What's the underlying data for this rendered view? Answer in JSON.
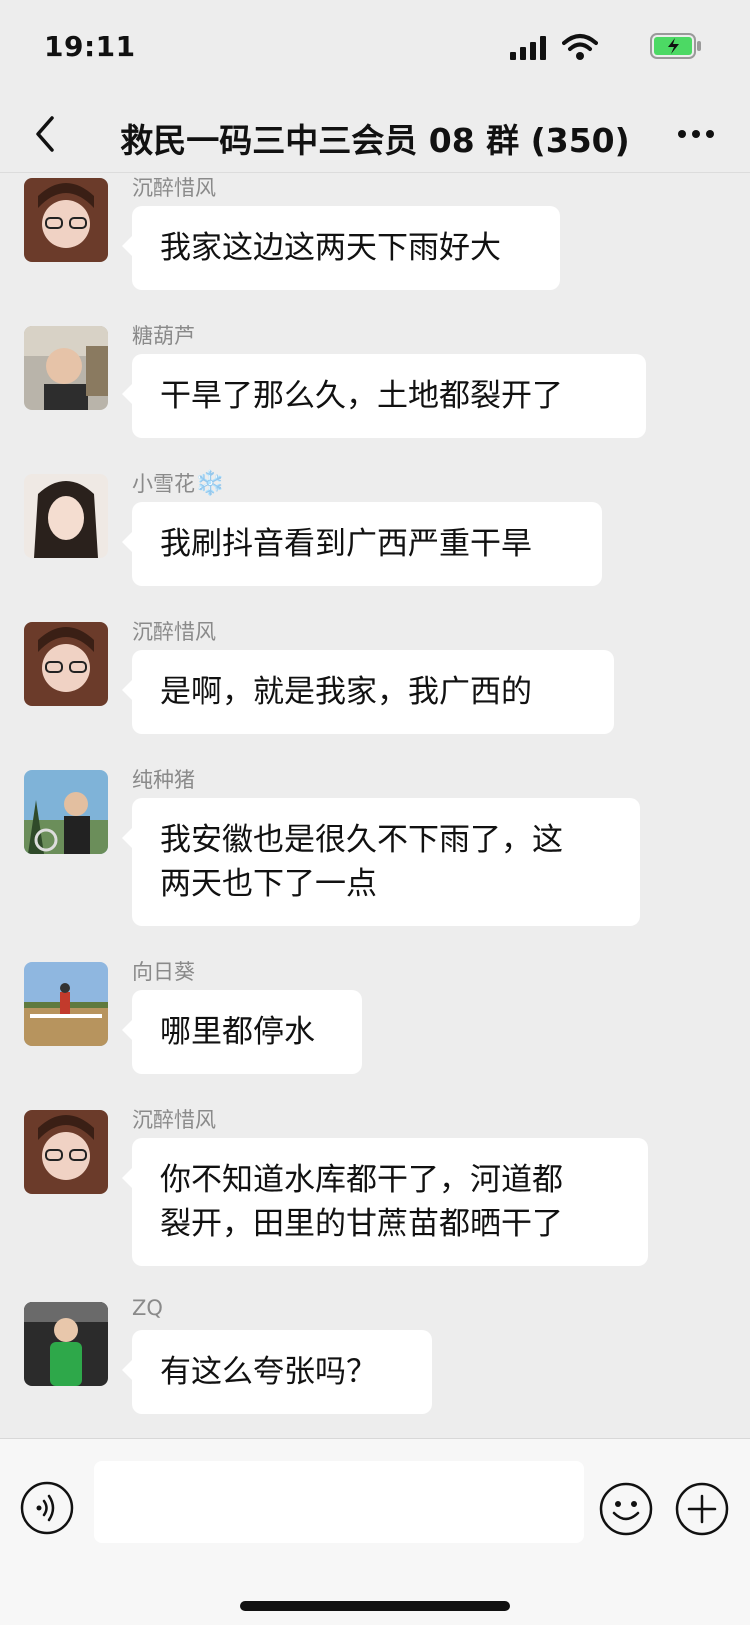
{
  "status": {
    "time": "19:11"
  },
  "header": {
    "title": "救民一码三中三会员 08 群 (350)"
  },
  "messages": [
    {
      "sender": "沉醉惜风",
      "text": "我家这边这两天下雨好大"
    },
    {
      "sender": "糖葫芦",
      "text": "干旱了那么久，土地都裂开了"
    },
    {
      "sender": "小雪花",
      "sender_emoji": "❄️",
      "text": "我刷抖音看到广西严重干旱"
    },
    {
      "sender": "沉醉惜风",
      "text": "是啊，就是我家，我广西的"
    },
    {
      "sender": "纯种猪",
      "text_lines": [
        "我安徽也是很久不下雨了，这",
        "两天也下了一点"
      ]
    },
    {
      "sender": "向日葵",
      "text": "哪里都停水"
    },
    {
      "sender": "沉醉惜风",
      "text_lines": [
        "你不知道水库都干了，河道都",
        "裂开，田里的甘蔗苗都晒干了"
      ]
    },
    {
      "sender": "ZQ",
      "text": "有这么夸张吗？"
    }
  ],
  "input": {
    "value": ""
  },
  "icons": {
    "back": "chevron-left-icon",
    "more": "more-dots-icon",
    "voice": "voice-icon",
    "emoji": "emoji-icon",
    "plus": "plus-icon"
  }
}
